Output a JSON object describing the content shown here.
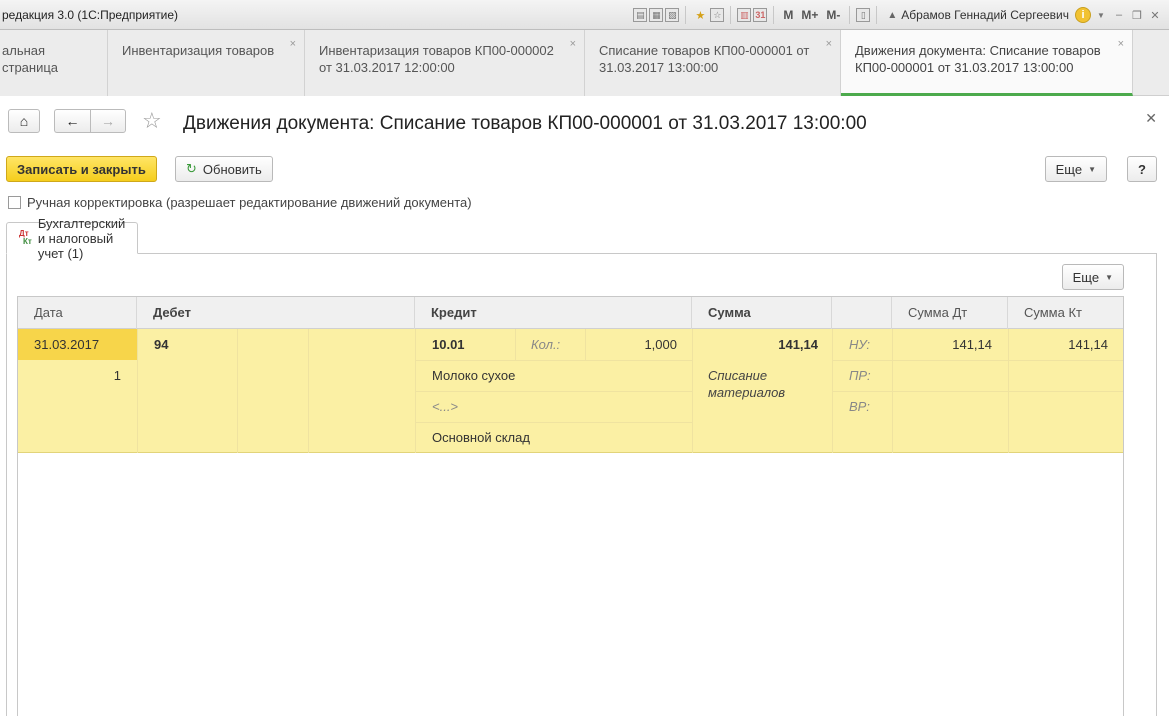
{
  "window": {
    "app_title": "редакция 3.0  (1С:Предприятие)",
    "user_name": "Абрамов Геннадий Сергеевич",
    "mem_buttons": [
      "M",
      "M+",
      "M-"
    ]
  },
  "tabs": [
    {
      "line1": "альная страница",
      "line2": "",
      "closable": false
    },
    {
      "line1": "Инвентаризация товаров",
      "line2": "",
      "closable": true
    },
    {
      "line1": "Инвентаризация товаров КП00-000002",
      "line2": "от 31.03.2017 12:00:00",
      "closable": true
    },
    {
      "line1": "Списание товаров КП00-000001 от",
      "line2": "31.03.2017 13:00:00",
      "closable": true
    },
    {
      "line1": "Движения документа: Списание товаров",
      "line2": "КП00-000001 от 31.03.2017 13:00:00",
      "closable": true,
      "active": true
    }
  ],
  "header": {
    "title": "Движения документа: Списание товаров КП00-000001 от 31.03.2017 13:00:00"
  },
  "toolbar": {
    "save_close_label": "Записать и закрыть",
    "refresh_label": "Обновить",
    "more_label": "Еще",
    "help_label": "?"
  },
  "manual_edit": {
    "label": "Ручная корректировка (разрешает редактирование движений документа)",
    "checked": false
  },
  "inner_tab": {
    "label": "Бухгалтерский и налоговый учет (1)",
    "icon_top": "Дт",
    "icon_bottom": "Кт"
  },
  "panel": {
    "more_label": "Еще"
  },
  "grid": {
    "columns": [
      "Дата",
      "Дебет",
      "Кредит",
      "Сумма",
      "",
      "Сумма Дт",
      "Сумма Кт"
    ],
    "row": {
      "date": "31.03.2017",
      "line_no": "1",
      "debit_account": "94",
      "credit_account": "10.01",
      "qty_label": "Кол.:",
      "qty": "1,000",
      "sum": "141,14",
      "credit_subconto1": "Молоко сухое",
      "credit_subconto2": "<...>",
      "credit_subconto3": "Основной склад",
      "content": "Списание материалов",
      "nu_label": "НУ:",
      "pr_label": "ПР:",
      "vr_label": "ВР:",
      "sum_dt": "141,14",
      "sum_kt": "141,14"
    }
  }
}
